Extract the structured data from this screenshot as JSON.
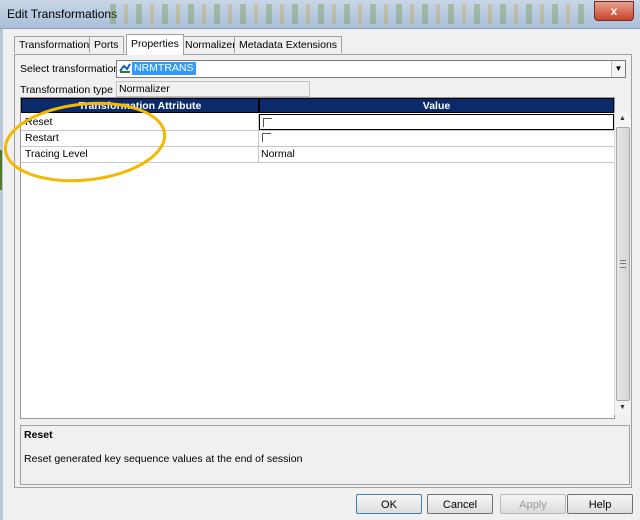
{
  "window": {
    "title": "Edit Transformations",
    "close_label": "x"
  },
  "tabs": [
    {
      "label": "Transformation"
    },
    {
      "label": "Ports"
    },
    {
      "label": "Properties"
    },
    {
      "label": "Normalizer"
    },
    {
      "label": "Metadata Extensions"
    }
  ],
  "select_transformation": {
    "label": "Select transformation:",
    "value": "NRMTRANS"
  },
  "transformation_type": {
    "label": "Transformation type",
    "value": "Normalizer"
  },
  "grid": {
    "headers": {
      "attribute": "Transformation Attribute",
      "value": "Value"
    },
    "rows": [
      {
        "attribute": "Reset",
        "value": "",
        "checkbox": true
      },
      {
        "attribute": "Restart",
        "value": "",
        "checkbox": true
      },
      {
        "attribute": "Tracing Level",
        "value": "Normal",
        "checkbox": false
      }
    ]
  },
  "description": {
    "title": "Reset",
    "text": "Reset generated key sequence values at the end of session"
  },
  "buttons": {
    "ok": "OK",
    "cancel": "Cancel",
    "apply": "Apply",
    "help": "Help"
  },
  "colors": {
    "header_bg": "#0a2a6b",
    "selection": "#3399ff",
    "annotation": "#f5b800"
  }
}
